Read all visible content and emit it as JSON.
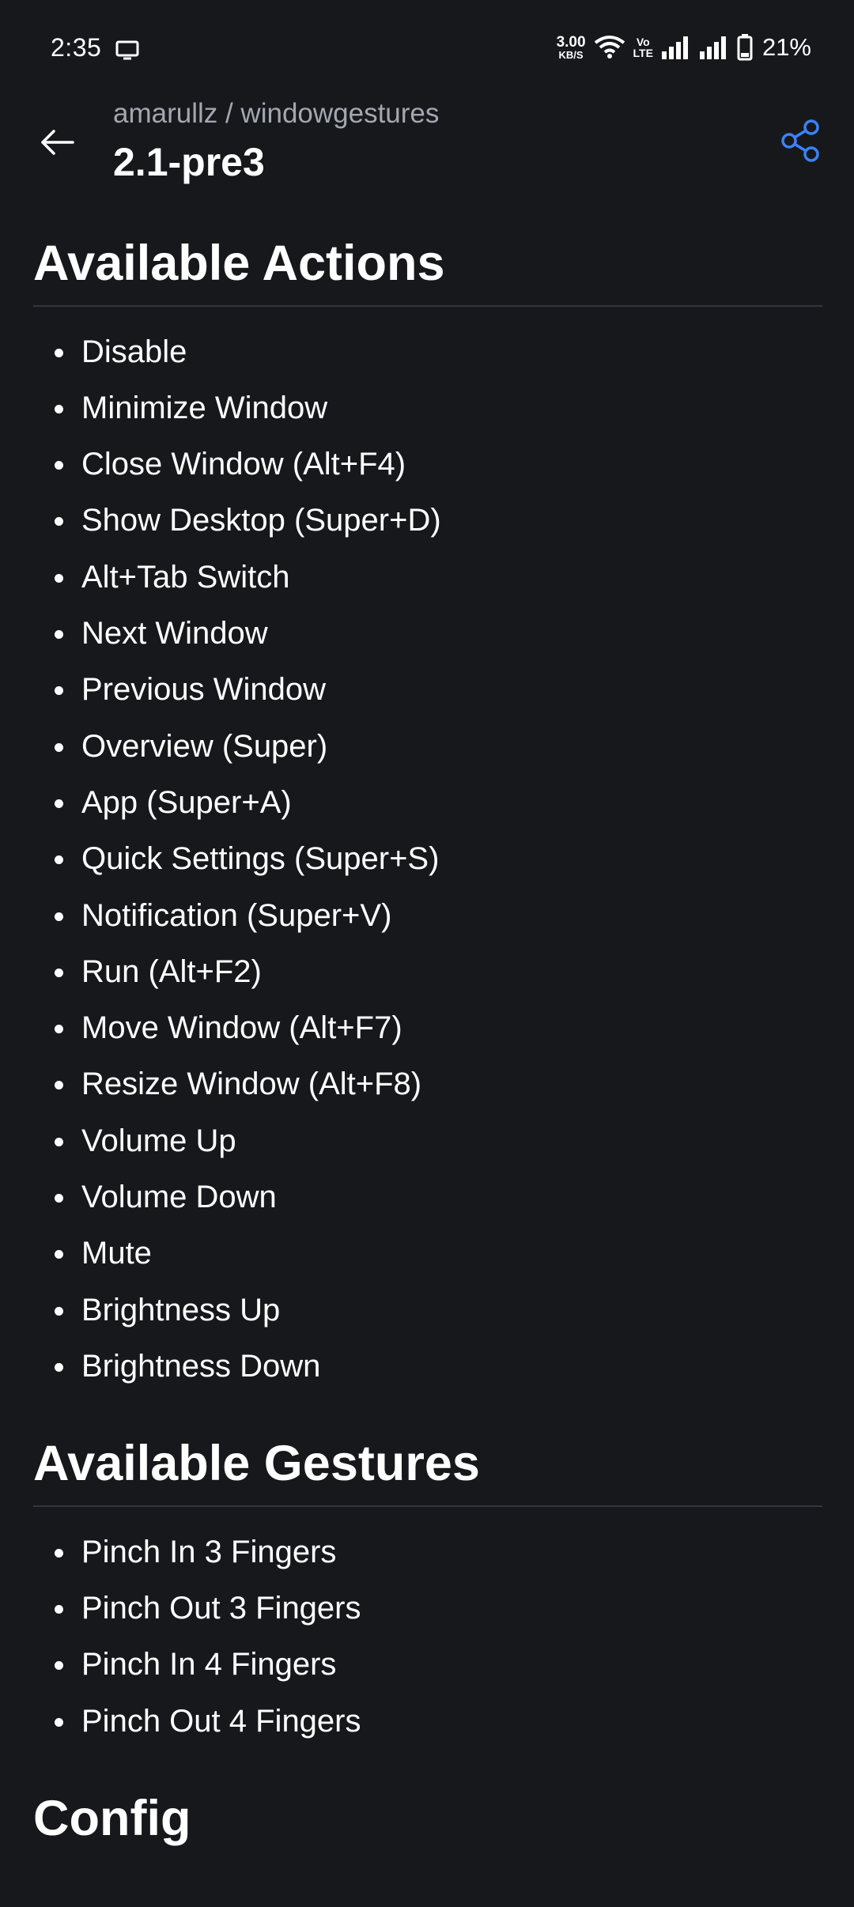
{
  "status_bar": {
    "time": "2:35",
    "net_speed_value": "3.00",
    "net_speed_unit": "KB/S",
    "volte_top": "Vo",
    "volte_bottom": "LTE",
    "battery": "21%"
  },
  "header": {
    "repo_path": "amarullz / windowgestures",
    "release_title": "2.1-pre3",
    "back_icon": "arrow-left-icon",
    "share_icon": "share-icon",
    "accent_color": "#3b82f6"
  },
  "sections": {
    "actions": {
      "heading": "Available Actions",
      "items": [
        "Disable",
        "Minimize Window",
        "Close Window (Alt+F4)",
        "Show Desktop (Super+D)",
        "Alt+Tab Switch",
        "Next Window",
        "Previous Window",
        "Overview (Super)",
        "App (Super+A)",
        "Quick Settings (Super+S)",
        "Notification (Super+V)",
        "Run (Alt+F2)",
        "Move Window (Alt+F7)",
        "Resize Window (Alt+F8)",
        "Volume Up",
        "Volume Down",
        "Mute",
        "Brightness Up",
        "Brightness Down"
      ]
    },
    "gestures": {
      "heading": "Available Gestures",
      "items": [
        "Pinch In 3 Fingers",
        "Pinch Out 3 Fingers",
        "Pinch In 4 Fingers",
        "Pinch Out 4 Fingers"
      ]
    },
    "config": {
      "heading": "Config"
    }
  }
}
